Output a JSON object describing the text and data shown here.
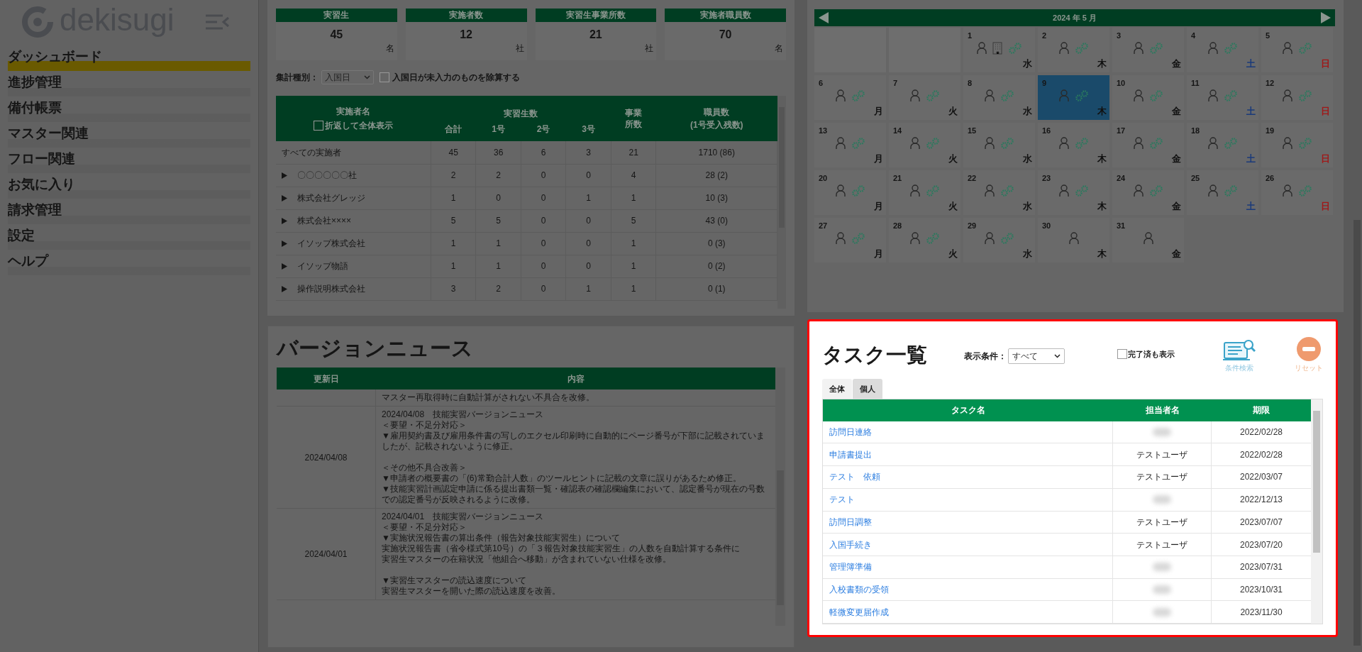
{
  "sidebar": {
    "logo": "dekisugi",
    "items": [
      {
        "label": "ダッシュボード",
        "selected": true
      },
      {
        "label": "進捗管理",
        "selected": false
      },
      {
        "label": "備付帳票",
        "selected": false
      },
      {
        "label": "マスター関連",
        "selected": false
      },
      {
        "label": "フロー関連",
        "selected": false
      },
      {
        "label": "お気に入り",
        "selected": false
      },
      {
        "label": "請求管理",
        "selected": false
      },
      {
        "label": "設定",
        "selected": false
      },
      {
        "label": "ヘルプ",
        "selected": false
      }
    ]
  },
  "stats": [
    {
      "label": "実習生",
      "value": "45",
      "unit": "名"
    },
    {
      "label": "実施者数",
      "value": "12",
      "unit": "社"
    },
    {
      "label": "実習生事業所数",
      "value": "21",
      "unit": "社"
    },
    {
      "label": "実施者職員数",
      "value": "70",
      "unit": "名"
    }
  ],
  "summary": {
    "filter_label": "集計種別：",
    "filter_value": "入国日",
    "exclude": {
      "label": "入国日が未入力のものを除算する",
      "checked": false
    },
    "columns": {
      "name": "実施者名",
      "wrap": {
        "label": "折返して全体表示",
        "checked": false
      },
      "trainees": "実習生数",
      "sub": [
        "合計",
        "1号",
        "2号",
        "3号"
      ],
      "offices": "事業所数",
      "staff": "職員数\n(1号受入残数)"
    },
    "rows": [
      {
        "name": "すべての実施者",
        "expandable": false,
        "cells": [
          "45",
          "36",
          "6",
          "3",
          "21",
          "1710 (86)"
        ]
      },
      {
        "name": "〇〇〇〇〇〇社",
        "expandable": true,
        "cells": [
          "2",
          "2",
          "0",
          "0",
          "4",
          "28 (2)"
        ]
      },
      {
        "name": "株式会社グレッジ",
        "expandable": true,
        "cells": [
          "1",
          "0",
          "0",
          "1",
          "1",
          "10 (3)"
        ]
      },
      {
        "name": "株式会社××××",
        "expandable": true,
        "cells": [
          "5",
          "5",
          "0",
          "0",
          "5",
          "43 (0)"
        ]
      },
      {
        "name": "イソップ株式会社",
        "expandable": true,
        "cells": [
          "1",
          "1",
          "0",
          "0",
          "1",
          "0 (3)"
        ]
      },
      {
        "name": "イソップ物語",
        "expandable": true,
        "cells": [
          "1",
          "1",
          "0",
          "0",
          "1",
          "0 (2)"
        ]
      },
      {
        "name": "操作説明株式会社",
        "expandable": true,
        "cells": [
          "3",
          "2",
          "0",
          "1",
          "1",
          "0 (1)"
        ]
      }
    ]
  },
  "calendar": {
    "title": "2024 年 5 月",
    "days": [
      {
        "kind": "blank"
      },
      {
        "kind": "blank"
      },
      {
        "kind": "day",
        "day": "1",
        "weekday": "水",
        "color": "#111111",
        "person": true,
        "office": true,
        "gears": true,
        "selected": false
      },
      {
        "kind": "day",
        "day": "2",
        "weekday": "木",
        "color": "#111111",
        "person": true,
        "office": false,
        "gears": true,
        "selected": false
      },
      {
        "kind": "day",
        "day": "3",
        "weekday": "金",
        "color": "#111111",
        "person": true,
        "office": false,
        "gears": true,
        "selected": false
      },
      {
        "kind": "day",
        "day": "4",
        "weekday": "土",
        "color": "#1a3a7a",
        "person": true,
        "office": false,
        "gears": true,
        "selected": false
      },
      {
        "kind": "day",
        "day": "5",
        "weekday": "日",
        "color": "#a01818",
        "person": true,
        "office": false,
        "gears": true,
        "selected": false
      },
      {
        "kind": "day",
        "day": "6",
        "weekday": "月",
        "color": "#111111",
        "person": true,
        "office": false,
        "gears": true,
        "selected": false
      },
      {
        "kind": "day",
        "day": "7",
        "weekday": "火",
        "color": "#111111",
        "person": true,
        "office": false,
        "gears": true,
        "selected": false
      },
      {
        "kind": "day",
        "day": "8",
        "weekday": "水",
        "color": "#111111",
        "person": true,
        "office": false,
        "gears": true,
        "selected": false
      },
      {
        "kind": "day",
        "day": "9",
        "weekday": "木",
        "color": "#111111",
        "person": true,
        "office": false,
        "gears": true,
        "selected": true
      },
      {
        "kind": "day",
        "day": "10",
        "weekday": "金",
        "color": "#111111",
        "person": true,
        "office": false,
        "gears": true,
        "selected": false
      },
      {
        "kind": "day",
        "day": "11",
        "weekday": "土",
        "color": "#1a3a7a",
        "person": true,
        "office": false,
        "gears": true,
        "selected": false
      },
      {
        "kind": "day",
        "day": "12",
        "weekday": "日",
        "color": "#a01818",
        "person": true,
        "office": false,
        "gears": true,
        "selected": false
      },
      {
        "kind": "day",
        "day": "13",
        "weekday": "月",
        "color": "#111111",
        "person": true,
        "office": false,
        "gears": true,
        "selected": false
      },
      {
        "kind": "day",
        "day": "14",
        "weekday": "火",
        "color": "#111111",
        "person": true,
        "office": false,
        "gears": true,
        "selected": false
      },
      {
        "kind": "day",
        "day": "15",
        "weekday": "水",
        "color": "#111111",
        "person": true,
        "office": false,
        "gears": true,
        "selected": false
      },
      {
        "kind": "day",
        "day": "16",
        "weekday": "木",
        "color": "#111111",
        "person": true,
        "office": false,
        "gears": true,
        "selected": false
      },
      {
        "kind": "day",
        "day": "17",
        "weekday": "金",
        "color": "#111111",
        "person": true,
        "office": false,
        "gears": true,
        "selected": false
      },
      {
        "kind": "day",
        "day": "18",
        "weekday": "土",
        "color": "#1a3a7a",
        "person": true,
        "office": false,
        "gears": true,
        "selected": false
      },
      {
        "kind": "day",
        "day": "19",
        "weekday": "日",
        "color": "#a01818",
        "person": true,
        "office": false,
        "gears": true,
        "selected": false
      },
      {
        "kind": "day",
        "day": "20",
        "weekday": "月",
        "color": "#111111",
        "person": true,
        "office": false,
        "gears": true,
        "selected": false
      },
      {
        "kind": "day",
        "day": "21",
        "weekday": "火",
        "color": "#111111",
        "person": true,
        "office": false,
        "gears": true,
        "selected": false
      },
      {
        "kind": "day",
        "day": "22",
        "weekday": "水",
        "color": "#111111",
        "person": true,
        "office": false,
        "gears": true,
        "selected": false
      },
      {
        "kind": "day",
        "day": "23",
        "weekday": "木",
        "color": "#111111",
        "person": true,
        "office": false,
        "gears": true,
        "selected": false
      },
      {
        "kind": "day",
        "day": "24",
        "weekday": "金",
        "color": "#111111",
        "person": true,
        "office": false,
        "gears": true,
        "selected": false
      },
      {
        "kind": "day",
        "day": "25",
        "weekday": "土",
        "color": "#1a3a7a",
        "person": true,
        "office": false,
        "gears": true,
        "selected": false
      },
      {
        "kind": "day",
        "day": "26",
        "weekday": "日",
        "color": "#a01818",
        "person": true,
        "office": false,
        "gears": true,
        "selected": false
      },
      {
        "kind": "day",
        "day": "27",
        "weekday": "月",
        "color": "#111111",
        "person": true,
        "office": false,
        "gears": true,
        "selected": false
      },
      {
        "kind": "day",
        "day": "28",
        "weekday": "火",
        "color": "#111111",
        "person": true,
        "office": false,
        "gears": true,
        "selected": false
      },
      {
        "kind": "day",
        "day": "29",
        "weekday": "水",
        "color": "#111111",
        "person": true,
        "office": false,
        "gears": true,
        "selected": false
      },
      {
        "kind": "day",
        "day": "30",
        "weekday": "木",
        "color": "#111111",
        "person": true,
        "office": false,
        "gears": false,
        "selected": false
      },
      {
        "kind": "day",
        "day": "31",
        "weekday": "金",
        "color": "#111111",
        "person": true,
        "office": false,
        "gears": false,
        "selected": false
      }
    ]
  },
  "version_news": {
    "title": "バージョンニュース",
    "columns": [
      "更新日",
      "内容"
    ],
    "rows": [
      {
        "paragraphs": [
          [
            "マスター再取得時に自動計算がされない不具合を改修。"
          ]
        ]
      },
      {
        "date": "2024/04/08",
        "paragraphs": [
          [
            "2024/04/08　技能実習バージョンニュース",
            "＜要望・不足分対応＞",
            "▼雇用契約書及び雇用条件書の写しのエクセル印刷時に自動的にページ番号が下部に記載されていましたが、記載されないように修正。"
          ],
          [
            "＜その他不具合改善＞",
            "▼申請者の概要書の「(6)常勤合計人数」のツールヒントに記載の文章に誤りがあるため修正。",
            "▼技能実習計画認定申請に係る提出書類一覧・確認表の確認欄編集において、認定番号が現在の号数での認定番号が反映されるように改修。"
          ]
        ]
      },
      {
        "date": "2024/04/01",
        "paragraphs": [
          [
            "2024/04/01　技能実習バージョンニュース",
            "＜要望・不足分対応＞",
            "▼実施状況報告書の算出条件（報告対象技能実習生）について",
            "実施状況報告書（省令様式第10号）の「３報告対象技能実習生」の人数を自動計算する条件に",
            "実習生マスターの在籍状況「他組合へ移動」が含まれていない仕様を改修。"
          ],
          [
            "▼実習生マスターの読込速度について",
            "実習生マスターを開いた際の読込速度を改善。"
          ]
        ]
      }
    ]
  },
  "tasks": {
    "title": "タスク一覧",
    "filter_label": "表示条件：",
    "filter_value": "すべて",
    "show_done": {
      "label": "完了済も表示",
      "checked": false
    },
    "search_label": "条件検索",
    "reset_label": "リセット",
    "tabs": [
      {
        "label": "全体",
        "selected": true
      },
      {
        "label": "個人",
        "selected": false
      }
    ],
    "columns": [
      "タスク名",
      "担当者名",
      "期限"
    ],
    "rows": [
      {
        "name": "訪問日連絡",
        "assignee_blurred": true,
        "due": "2022/02/28"
      },
      {
        "name": "申請書提出",
        "assignee": "テストユーザ",
        "assignee_blurred": false,
        "due": "2022/02/28"
      },
      {
        "name": "テスト　依頼",
        "assignee": "テストユーザ",
        "assignee_blurred": false,
        "due": "2022/03/07"
      },
      {
        "name": "テスト",
        "assignee_blurred": true,
        "due": "2022/12/13"
      },
      {
        "name": "訪問日調整",
        "assignee": "テストユーザ",
        "assignee_blurred": false,
        "due": "2023/07/07"
      },
      {
        "name": "入国手続き",
        "assignee": "テストユーザ",
        "assignee_blurred": false,
        "due": "2023/07/20"
      },
      {
        "name": "管理簿準備",
        "assignee_blurred": true,
        "due": "2023/07/31"
      },
      {
        "name": "入校書類の受領",
        "assignee_blurred": true,
        "due": "2023/10/31"
      },
      {
        "name": "軽微変更届作成",
        "assignee_blurred": true,
        "due": "2023/11/30"
      }
    ]
  }
}
